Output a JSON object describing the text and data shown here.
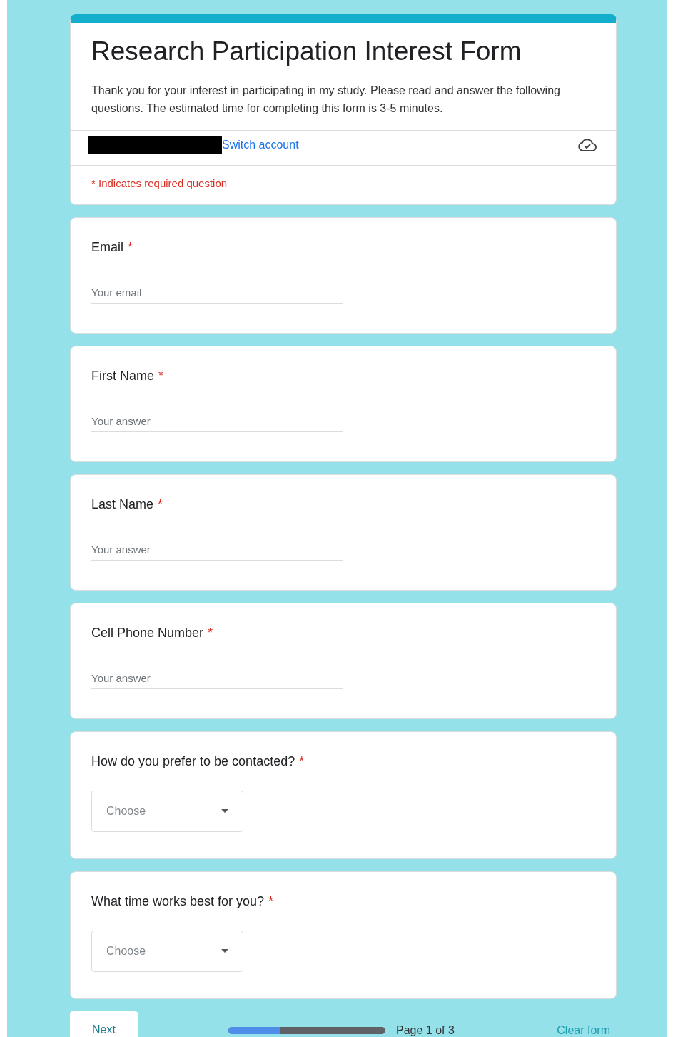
{
  "form": {
    "title": "Research Participation Interest Form",
    "description": "Thank you for your interest in participating in my study. Please read and answer the following questions. The estimated time for completing this form is 3-5 minutes.",
    "account_link": "Switch account",
    "required_note": "* Indicates required question"
  },
  "questions": [
    {
      "kind": "text",
      "label": "Email",
      "required_mark": "*",
      "placeholder": "Your email"
    },
    {
      "kind": "text",
      "label": "First Name",
      "required_mark": "*",
      "placeholder": "Your answer"
    },
    {
      "kind": "text",
      "label": "Last Name",
      "required_mark": "*",
      "placeholder": "Your answer"
    },
    {
      "kind": "text",
      "label": "Cell Phone Number",
      "required_mark": "*",
      "placeholder": "Your answer"
    },
    {
      "kind": "dropdown",
      "label": "How do you prefer to be contacted?",
      "required_mark": "*",
      "placeholder": "Choose"
    },
    {
      "kind": "dropdown",
      "label": "What time works best for you?",
      "required_mark": "*",
      "placeholder": "Choose"
    }
  ],
  "footer": {
    "next_button": "Next",
    "progress": {
      "level": 0.33
    },
    "page_label": "Page 1 of 3",
    "clear_button": "Clear form"
  }
}
